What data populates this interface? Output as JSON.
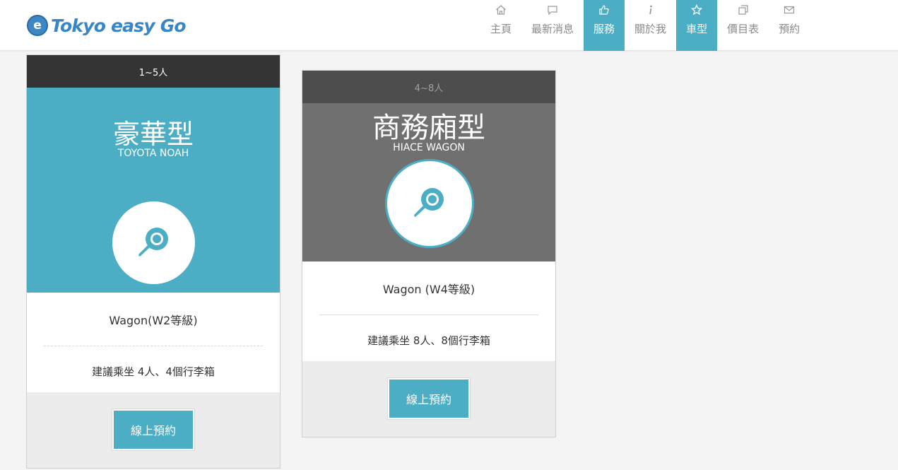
{
  "brand": {
    "logo_letter": "e",
    "name": "Tokyo easy Go",
    "color": "#3a86c4"
  },
  "accent_color": "#4caec5",
  "nav": [
    {
      "label": "主頁",
      "icon": "home-icon",
      "active": false
    },
    {
      "label": "最新消息",
      "icon": "comment-icon",
      "active": false
    },
    {
      "label": "服務",
      "icon": "thumbs-up-icon",
      "active": true
    },
    {
      "label": "關於我",
      "icon": "info-icon",
      "active": false
    },
    {
      "label": "車型",
      "icon": "star-icon",
      "active": true
    },
    {
      "label": "價目表",
      "icon": "copy-icon",
      "active": false
    },
    {
      "label": "預約",
      "icon": "envelope-icon",
      "active": false
    }
  ],
  "cards": [
    {
      "capacity_range": "1~5人",
      "title": "豪華型",
      "subtitle": "TOYOTA NOAH",
      "icon": "magnifier-icon",
      "model": "Wagon(W2等級)",
      "capacity": "建議乘坐 4人、4個行李箱",
      "button": "線上預約"
    },
    {
      "capacity_range": "4~8人",
      "title": "商務廂型",
      "subtitle": "HIACE WAGON",
      "icon": "magnifier-icon",
      "model": "Wagon (W4等級)",
      "capacity": "建議乘坐 8人、8個行李箱",
      "button": "線上預約"
    }
  ]
}
